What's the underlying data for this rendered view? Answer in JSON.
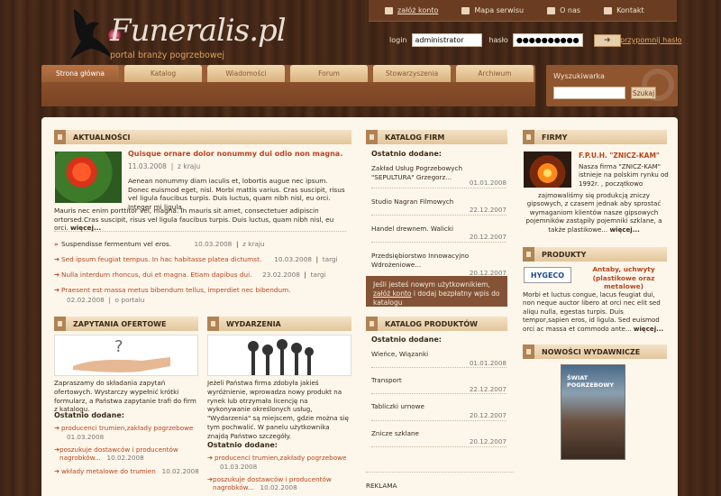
{
  "header": {
    "logo_text": "Funeralis.pl",
    "logo_subtitle": "portal branży pogrzebowej",
    "top_links": [
      "załóż konto",
      "Mapa serwisu",
      "O nas",
      "Kontakt"
    ],
    "login_label": "login",
    "login_value": "administrator",
    "password_label": "hasło",
    "password_value": "●●●●●●●●●●●",
    "forgot_label": "przypomnij hasło"
  },
  "nav": {
    "tabs": [
      "Strona główna",
      "Katalog",
      "Wiadomości",
      "Forum",
      "Stowarzyszenia",
      "Archiwum"
    ]
  },
  "search": {
    "title": "Wyszukiwarka",
    "button": "Szukaj"
  },
  "news": {
    "header": "AKTUALNOŚCI",
    "lead_title": "Quisque ornare dolor nonummy dui odio non magna.",
    "lead_date": "11.03.2008",
    "lead_category": "z kraju",
    "lead_body_1": "Aenean nonummy diam iaculis et, lobortis augue nec ipsum. Donec euismod eget, nisl. Morbi mattis varius. Cras suscipit, risus vel ligula faucibus turpis. Duis luctus, quam nibh nisl, eu orci. Integer mi ligula.",
    "lead_body_2": "Mauris nec enim porttitor vel, magna. In mauris sit amet, consectetuer adipiscin ortorsed.Cras suscipit, risus vel ligula faucibus turpis. Duis luctus, quam nibh nisl, eu orci.",
    "more": "więcej...",
    "items": [
      {
        "title": "Suspendisse fermentum vel eros.",
        "date": "10.03.2008",
        "cat": "z kraju"
      },
      {
        "title": "Sed ipsum feugiat tempus. In hac habitasse platea dictumst.",
        "date": "10.03.2008",
        "cat": "targi"
      },
      {
        "title": "Nulla interdum rhoncus, dui et magna. Etiam dapibus dui.",
        "date": "23.02.2008",
        "cat": "targi"
      },
      {
        "title": "Praesent est massa metus bibendum tellus, imperdiet nec bibendum.",
        "date": "02.02.2008",
        "cat": "o portalu"
      }
    ]
  },
  "offers": {
    "header": "ZAPYTANIA OFERTOWE",
    "body": "Zapraszamy do składania zapytań ofertowych. Wystarczy wypełnić krótki formularz, a Państwa zapytanie trafi do firm z katalogu.",
    "sub": "Ostatnio dodane:",
    "items": [
      {
        "title": "producenci trumien,zakłady pogrzebowe",
        "date": "01.03.2008"
      },
      {
        "title": "poszukuje dostawców i producentów nagrobków...",
        "date": "10.02.2008"
      },
      {
        "title": "wkłady metalowe do trumien",
        "date": "10.02.2008"
      }
    ]
  },
  "events": {
    "header": "WYDARZENIA",
    "body": "Jeżeli Państwa firma zdobyła jakieś wyróżnienie, wprowadza nowy produkt na rynek lub otrzymała licencję na wykonywanie określonych usług, \"Wydarzenia\" są miejscem, gdzie można się tym pochwalić. W panelu użytkownika znajdą Państwo szczegóły.",
    "sub": "Ostatnio dodane:",
    "items": [
      {
        "title": "producenci trumien,zakłady pogrzebowe",
        "date": "01.03.2008"
      },
      {
        "title": "poszukuje dostawców i producentów nagrobków...",
        "date": "10.02.2008"
      }
    ]
  },
  "catalog": {
    "header": "KATALOG FIRM",
    "sub": "Ostatnio dodane:",
    "items": [
      {
        "title": "Zakład Usług Pogrzebowych \"SEPULTURA\" Grzegorz...",
        "date": "01.01.2008"
      },
      {
        "title": "Studio Nagran Filmowych",
        "date": "22.12.2007"
      },
      {
        "title": "Handel drewnem. Walicki",
        "date": "20.12.2007"
      },
      {
        "title": "Przedsiębiorstwo Innowacyjno Wdrożeniowe...",
        "date": "20.12.2007"
      }
    ],
    "promo_1": "Jeśli jesteś nowym użytkownikiem,",
    "promo_link": "załóż konto",
    "promo_2": "i dodaj bezpłatny wpis do katalogu"
  },
  "products_catalog": {
    "header": "KATALOG PRODUKTÓW",
    "sub": "Ostatnio dodane:",
    "items": [
      {
        "title": "Wieńce, Wiązanki",
        "date": "01.01.2008"
      },
      {
        "title": "Transport",
        "date": "22.12.2007"
      },
      {
        "title": "Tabliczki urnowe",
        "date": "20.12.2007"
      },
      {
        "title": "Znicze szklane",
        "date": "20.12.2007"
      }
    ],
    "ad": "REKLAMA"
  },
  "companies": {
    "header": "FIRMY",
    "name": "F.P.U.H. \"ZNICZ-KAM\"",
    "body_1": "Nasza firma \"ZNICZ-KAM\" istnieje na polskim rynku od 1992r. , początkowo",
    "body_2": "zajmowaliśmy się produkcją zniczy gipsowych, z czasem jednak aby sprostać wymaganiom klientów nasze gipsowych pojemników zastąpiły pojemniki szklane, a także plastikowe...",
    "more": "więcej..."
  },
  "products": {
    "header": "PRODUKTY",
    "logo": "HYGECO",
    "title": "Antaby, uchwyty (plastikowe oraz metalowe)",
    "body": "Morbi et luctus congue, lacus feugiat dui, non neque auctor libero at orci nec elit sed aliqu nulla, egestas turpis. Duis tempor,sapien eros, id ligula. Sed euismod orci ac massa et commodo ante...",
    "more": "więcej..."
  },
  "publications": {
    "header": "NOWOŚCI WYDAWNICZE",
    "cover_text": "ŚWIAT POGRZEBOWY"
  }
}
